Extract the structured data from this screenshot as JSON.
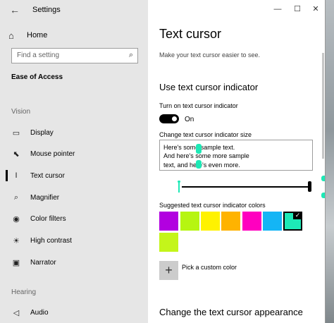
{
  "window": {
    "title": "Settings",
    "controls": {
      "minimize": "—",
      "maximize": "☐",
      "close": "✕"
    }
  },
  "sidebar": {
    "home_label": "Home",
    "search_placeholder": "Find a setting",
    "section_heading": "Ease of Access",
    "groups": [
      {
        "label": "Vision"
      },
      {
        "label": "Hearing"
      }
    ],
    "items": [
      {
        "label": "Display",
        "icon": "display-icon",
        "selected": false
      },
      {
        "label": "Mouse pointer",
        "icon": "mouse-pointer-icon",
        "selected": false
      },
      {
        "label": "Text cursor",
        "icon": "text-cursor-icon",
        "selected": true
      },
      {
        "label": "Magnifier",
        "icon": "magnifier-icon",
        "selected": false
      },
      {
        "label": "Color filters",
        "icon": "color-filters-icon",
        "selected": false
      },
      {
        "label": "High contrast",
        "icon": "high-contrast-icon",
        "selected": false
      },
      {
        "label": "Narrator",
        "icon": "narrator-icon",
        "selected": false
      },
      {
        "label": "Audio",
        "icon": "audio-icon",
        "selected": false
      }
    ]
  },
  "main": {
    "title": "Text cursor",
    "subtitle": "Make your text cursor easier to see.",
    "indicator_heading": "Use text cursor indicator",
    "toggle_label": "Turn on text cursor indicator",
    "toggle_state": "On",
    "size_label": "Change text cursor indicator size",
    "preview_lines": [
      "Here's some sample text.",
      "And here's some more sample",
      "text, and here's even more."
    ],
    "colors_label": "Suggested text cursor indicator colors",
    "swatches": [
      {
        "color": "#b200e0",
        "selected": false
      },
      {
        "color": "#b6f511",
        "selected": false
      },
      {
        "color": "#fff200",
        "selected": false
      },
      {
        "color": "#ffb300",
        "selected": false
      },
      {
        "color": "#ff00bf",
        "selected": false
      },
      {
        "color": "#14b5f5",
        "selected": false
      },
      {
        "color": "#1de9b6",
        "selected": true
      },
      {
        "color": "#c4f51a",
        "selected": false
      }
    ],
    "custom_color_label": "Pick a custom color",
    "custom_color_icon": "plus-icon",
    "bottom_heading": "Change the text cursor appearance"
  },
  "colors": {
    "accent_indicator": "#1de9b6",
    "sidebar_bg": "#e6e6e6"
  }
}
